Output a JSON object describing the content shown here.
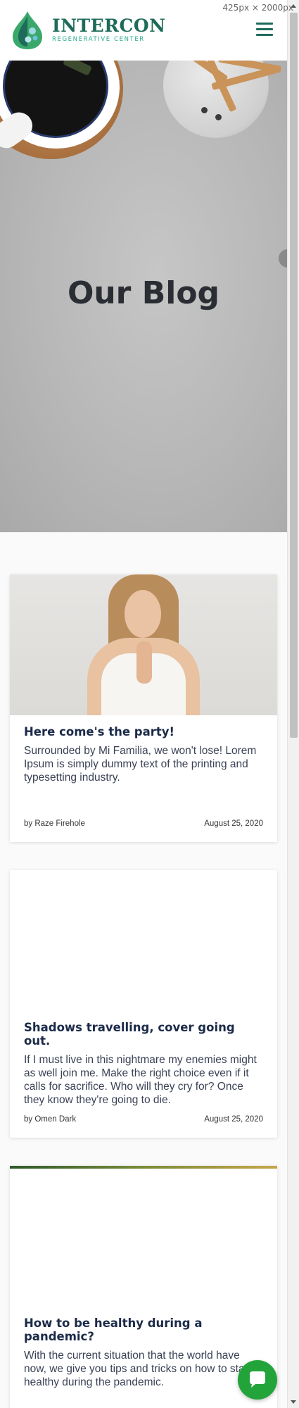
{
  "viewport_label": "425px × 2000px",
  "header": {
    "logo_name": "INTERCON",
    "logo_sub": "REGENERATIVE CENTER"
  },
  "hero": {
    "title": "Our Blog"
  },
  "posts": [
    {
      "title": "Here come's the party!",
      "excerpt": "Surrounded by Mi Familia, we won't lose! Lorem Ipsum is simply dummy text of the printing and typesetting industry.",
      "author": "by Raze Firehole",
      "date": "August 25, 2020"
    },
    {
      "title": "Shadows travelling, cover going out.",
      "excerpt": "If I must live in this nightmare my enemies might as well join me. Make the right choice even if it calls for sacrifice. Who will they cry for? Once they know they're going to die.",
      "author": "by Omen Dark",
      "date": "August 25, 2020"
    },
    {
      "title": "How to be healthy during a pandemic?",
      "excerpt": "With the current situation that the world have now, we give you tips and tricks on how to stay healthy during the pandemic."
    }
  ],
  "colors": {
    "brand": "#1f6b5a",
    "accent": "#2aa98b",
    "chat": "#23a43a"
  },
  "icons": {
    "menu": "hamburger-menu-icon",
    "chat": "chat-bubble-icon"
  }
}
